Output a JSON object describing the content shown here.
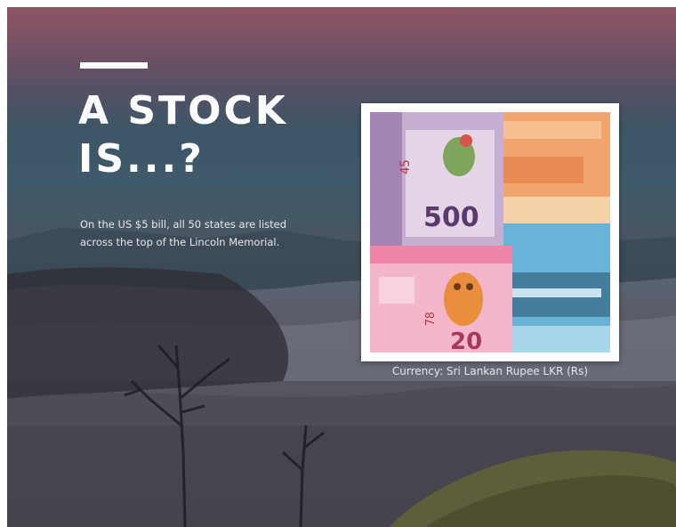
{
  "slide": {
    "title_line1": "A STOCK",
    "title_line2": "IS...?",
    "body_line1": "On the US $5 bill, all 50 states are listed",
    "body_line2": "across the top of the Lincoln Memorial.",
    "caption": "Currency: Sri Lankan Rupee LKR (Rs)"
  },
  "banknotes": {
    "note_500_value": "500",
    "note_20_value": "20",
    "serial_top": "45",
    "serial_bottom": "78"
  },
  "colors": {
    "accent": "#ffffff",
    "note_purple": "#b59ac2",
    "note_orange": "#f0a66a",
    "note_blue": "#5fb0d8",
    "note_pink": "#f08fb2"
  }
}
